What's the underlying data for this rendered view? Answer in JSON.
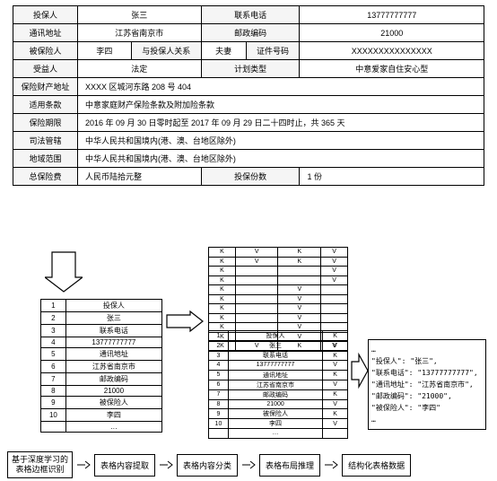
{
  "main": {
    "r1": {
      "c1": "投保人",
      "c2": "张三",
      "c3": "联系电话",
      "c4": "13777777777"
    },
    "r2": {
      "c1": "通讯地址",
      "c2": "江苏省南京市",
      "c3": "邮政编码",
      "c4": "21000"
    },
    "r3": {
      "c1": "被保险人",
      "c2": "李四",
      "c3": "与投保人关系",
      "c4": "夫妻",
      "c5": "证件号码",
      "c6": "XXXXXXXXXXXXXXX"
    },
    "r4": {
      "c1": "受益人",
      "c2": "法定",
      "c3": "计划类型",
      "c4": "中意爱家自住安心型"
    },
    "r5": {
      "c1": "保险财产地址",
      "c2": "XXXX 区城河东路 208 号 404"
    },
    "r6": {
      "c1": "适用条款",
      "c2": "中意家庭财产保险条款及附加险条款"
    },
    "r7": {
      "c1": "保险期限",
      "c2": "2016 年 09 月 30 日零时起至 2017 年 09 月 29 日二十四时止，共 365 天"
    },
    "r8": {
      "c1": "司法管辖",
      "c2": "中华人民共和国境内(港、澳、台地区除外)"
    },
    "r9": {
      "c1": "地域范围",
      "c2": "中华人民共和国境内(港、澳、台地区除外)"
    },
    "r10": {
      "c1": "总保险费",
      "c2": "人民币陆拾元整",
      "c3": "投保份数",
      "c4": "1 份"
    }
  },
  "list": {
    "rows": [
      {
        "n": "1",
        "t": "投保人"
      },
      {
        "n": "2",
        "t": "张三"
      },
      {
        "n": "3",
        "t": "联系电话"
      },
      {
        "n": "4",
        "t": "13777777777"
      },
      {
        "n": "5",
        "t": "通讯地址"
      },
      {
        "n": "6",
        "t": "江苏省南京市"
      },
      {
        "n": "7",
        "t": "邮政编码"
      },
      {
        "n": "8",
        "t": "21000"
      },
      {
        "n": "9",
        "t": "被保险人"
      },
      {
        "n": "10",
        "t": "李四"
      },
      {
        "n": "",
        "t": "…"
      }
    ]
  },
  "kv": {
    "rows": [
      {
        "a": "K",
        "b": "V",
        "c": "K",
        "d": "V"
      },
      {
        "a": "K",
        "b": "V",
        "c": "K",
        "d": "V"
      },
      {
        "a": "K",
        "b": "",
        "c": "",
        "d": "V"
      },
      {
        "a": "K",
        "b": "",
        "c": "",
        "d": "V"
      },
      {
        "a": "K",
        "b": "",
        "c": "V",
        "d": ""
      },
      {
        "a": "K",
        "b": "",
        "c": "V",
        "d": ""
      },
      {
        "a": "K",
        "b": "",
        "c": "V",
        "d": ""
      },
      {
        "a": "K",
        "b": "",
        "c": "V",
        "d": ""
      },
      {
        "a": "K",
        "b": "",
        "c": "V",
        "d": ""
      },
      {
        "a": "K",
        "b": "",
        "c": "V",
        "d": ""
      },
      {
        "a": "K",
        "b": "V",
        "c": "K",
        "d": "V"
      }
    ]
  },
  "list2": {
    "rows": [
      {
        "n": "1",
        "t": "投保人",
        "k": "K"
      },
      {
        "n": "2",
        "t": "张三",
        "k": "V"
      },
      {
        "n": "3",
        "t": "联系电话",
        "k": "K"
      },
      {
        "n": "4",
        "t": "13777777777",
        "k": "V"
      },
      {
        "n": "5",
        "t": "通讯地址",
        "k": "K"
      },
      {
        "n": "6",
        "t": "江苏省南京市",
        "k": "V"
      },
      {
        "n": "7",
        "t": "邮政编码",
        "k": "K"
      },
      {
        "n": "8",
        "t": "21000",
        "k": "V"
      },
      {
        "n": "9",
        "t": "被保险人",
        "k": "K"
      },
      {
        "n": "10",
        "t": "李四",
        "k": "V"
      },
      {
        "n": "",
        "t": "…",
        "k": ""
      }
    ]
  },
  "json": {
    "l1": "\"投保人\": \"张三\",",
    "l2": "\"联系电话\": \"13777777777\",",
    "l3": "\"通讯地址\": \"江苏省南京市\",",
    "l4": "\"邮政编码\": \"21000\",",
    "l5": "\"被保险人\": \"李四\""
  },
  "flow": {
    "b1": "基于深度学习的\n表格边框识别",
    "b2": "表格内容提取",
    "b3": "表格内容分类",
    "b4": "表格布局推理",
    "b5": "结构化表格数据"
  },
  "ellipsis": "…",
  "chart_data": {
    "type": "table",
    "description": "Pipeline diagram: insurance form table → extracted cell list → K/V classification → layout inference → structured JSON output",
    "form_fields": {
      "投保人": "张三",
      "联系电话": "13777777777",
      "通讯地址": "江苏省南京市",
      "邮政编码": "21000",
      "被保险人": "李四",
      "与投保人关系": "夫妻",
      "证件号码": "XXXXXXXXXXXXXXX",
      "受益人": "法定",
      "计划类型": "中意爱家自住安心型",
      "保险财产地址": "XXXX 区城河东路 208 号 404",
      "适用条款": "中意家庭财产保险条款及附加险条款",
      "保险期限": "2016 年 09 月 30 日零时起至 2017 年 09 月 29 日二十四时止，共 365 天",
      "司法管辖": "中华人民共和国境内(港、澳、台地区除外)",
      "地域范围": "中华人民共和国境内(港、澳、台地区除外)",
      "总保险费": "人民币陆拾元整",
      "投保份数": "1 份"
    },
    "pipeline_steps": [
      "基于深度学习的表格边框识别",
      "表格内容提取",
      "表格内容分类",
      "表格布局推理",
      "结构化表格数据"
    ]
  }
}
